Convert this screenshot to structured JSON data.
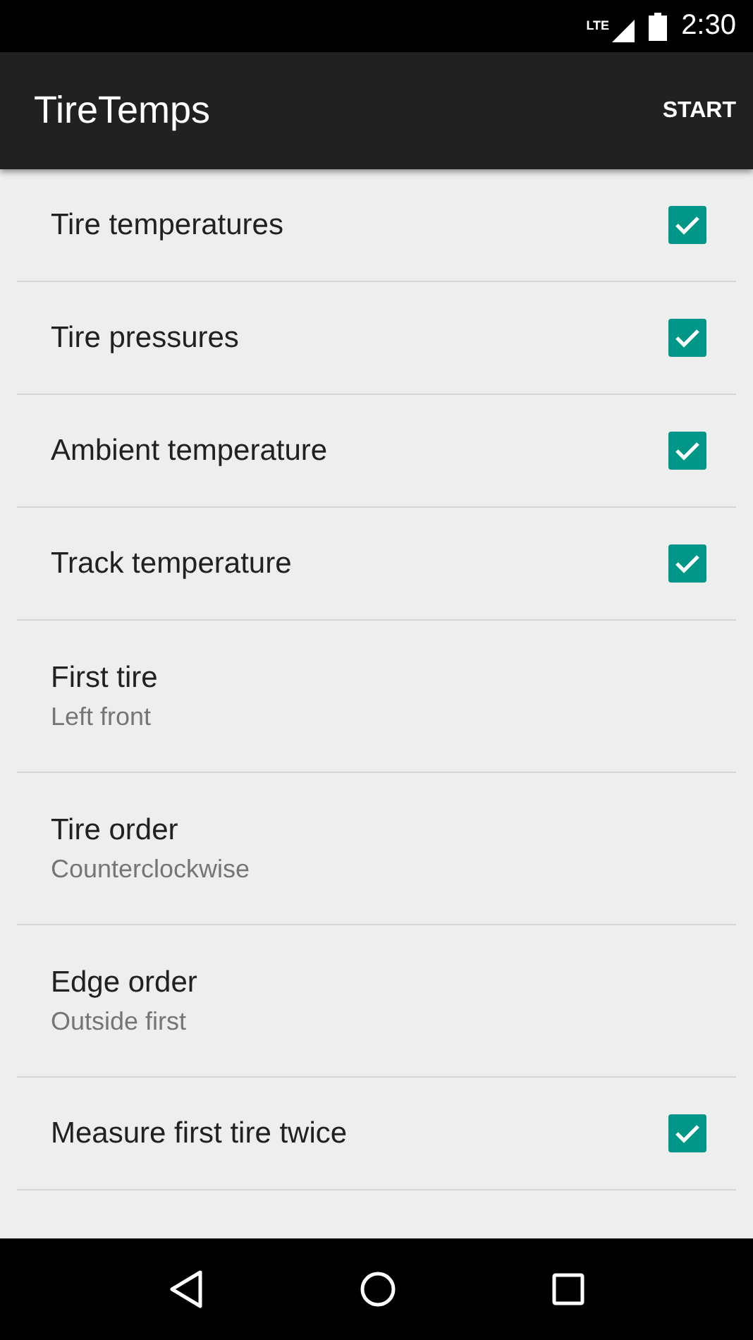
{
  "status_bar": {
    "network": "LTE",
    "time": "2:30"
  },
  "app_bar": {
    "title": "TireTemps",
    "action": "START"
  },
  "settings": [
    {
      "kind": "checkbox",
      "title": "Tire temperatures",
      "checked": true
    },
    {
      "kind": "checkbox",
      "title": "Tire pressures",
      "checked": true
    },
    {
      "kind": "checkbox",
      "title": "Ambient temperature",
      "checked": true
    },
    {
      "kind": "checkbox",
      "title": "Track temperature",
      "checked": true
    },
    {
      "kind": "choice",
      "title": "First tire",
      "summary": "Left front"
    },
    {
      "kind": "choice",
      "title": "Tire order",
      "summary": "Counterclockwise"
    },
    {
      "kind": "choice",
      "title": "Edge order",
      "summary": "Outside first"
    },
    {
      "kind": "checkbox",
      "title": "Measure first tire twice",
      "checked": true
    }
  ]
}
